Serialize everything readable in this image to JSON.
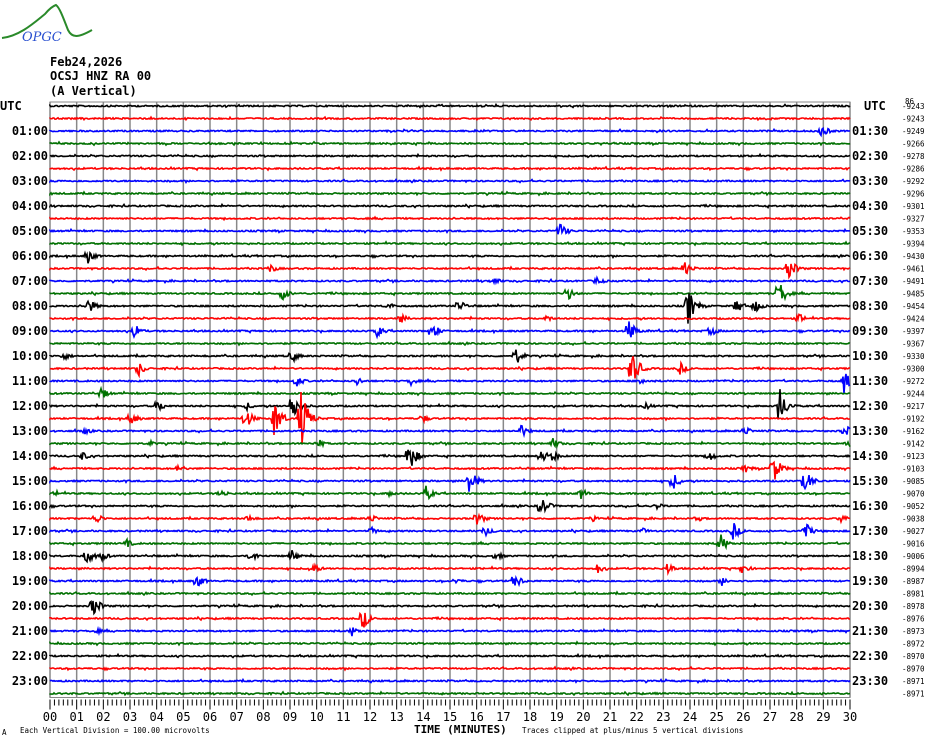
{
  "logo": {
    "text": "OPGC"
  },
  "header": {
    "date": "Feb24,2026",
    "station": "OCSJ HNZ RA 00",
    "component": "(A Vertical)"
  },
  "chart_data": {
    "type": "line",
    "title": "OCSJ HNZ RA 00 helicorder",
    "xlabel": "TIME (MINUTES)",
    "xlim": [
      0,
      30
    ],
    "x_ticks": [
      "00",
      "01",
      "02",
      "03",
      "04",
      "05",
      "06",
      "07",
      "08",
      "09",
      "10",
      "11",
      "12",
      "13",
      "14",
      "15",
      "16",
      "17",
      "18",
      "19",
      "20",
      "21",
      "22",
      "23",
      "24",
      "25",
      "26",
      "27",
      "28",
      "29",
      "30"
    ],
    "left_labels": [
      "UTC",
      "01:00",
      "02:00",
      "03:00",
      "04:00",
      "05:00",
      "06:00",
      "07:00",
      "08:00",
      "09:00",
      "10:00",
      "11:00",
      "12:00",
      "13:00",
      "14:00",
      "15:00",
      "16:00",
      "17:00",
      "18:00",
      "19:00",
      "20:00",
      "21:00",
      "22:00",
      "23:00"
    ],
    "right_labels": [
      "UTC",
      "01:30",
      "02:30",
      "03:30",
      "04:30",
      "05:30",
      "06:30",
      "07:30",
      "08:30",
      "09:30",
      "10:30",
      "11:30",
      "12:30",
      "13:30",
      "14:30",
      "15:30",
      "16:30",
      "17:30",
      "18:30",
      "19:30",
      "20:30",
      "21:30",
      "22:30",
      "23:30"
    ],
    "offset_top_label": "86",
    "trace_offsets": [
      "-9243",
      "-9243",
      "-9249",
      "-9266",
      "-9278",
      "-9286",
      "-9292",
      "-9296",
      "-9301",
      "-9327",
      "-9353",
      "-9394",
      "-9430",
      "-9461",
      "-9491",
      "-9485",
      "-9454",
      "-9424",
      "-9397",
      "-9367",
      "-9330",
      "-9300",
      "-9272",
      "-9244",
      "-9217",
      "-9192",
      "-9162",
      "-9142",
      "-9123",
      "-9103",
      "-9085",
      "-9070",
      "-9052",
      "-9038",
      "-9027",
      "-9016",
      "-9006",
      "-8994",
      "-8987",
      "-8981",
      "-8978",
      "-8976",
      "-8973",
      "-8972",
      "-8970",
      "-8970",
      "-8971",
      "-8971"
    ],
    "trace_colors": [
      "#000000",
      "#ff0000",
      "#0000ff",
      "#007000"
    ],
    "events_row_minute_amplitude_divisions": [
      [
        2,
        28.9,
        0.65
      ],
      [
        10,
        19.1,
        0.8
      ],
      [
        12,
        1.4,
        0.65
      ],
      [
        13,
        8.25,
        0.4
      ],
      [
        13,
        23.8,
        0.65
      ],
      [
        13,
        27.7,
        1.0
      ],
      [
        14,
        16.6,
        0.4
      ],
      [
        14,
        20.5,
        0.4
      ],
      [
        15,
        8.7,
        0.6
      ],
      [
        15,
        19.35,
        0.8
      ],
      [
        15,
        27.3,
        1.3
      ],
      [
        16,
        1.4,
        0.8
      ],
      [
        16,
        12.6,
        0.4
      ],
      [
        16,
        15.3,
        0.65
      ],
      [
        16,
        23.9,
        1.8
      ],
      [
        16,
        25.7,
        0.8
      ],
      [
        16,
        26.4,
        0.65
      ],
      [
        17,
        13.1,
        0.5
      ],
      [
        17,
        18.6,
        0.3
      ],
      [
        17,
        28.05,
        0.5
      ],
      [
        18,
        3.15,
        0.65
      ],
      [
        18,
        12.25,
        0.6
      ],
      [
        18,
        14.3,
        0.8
      ],
      [
        18,
        21.7,
        1.0
      ],
      [
        18,
        24.75,
        0.5
      ],
      [
        20,
        0.5,
        0.4
      ],
      [
        20,
        9.05,
        0.6
      ],
      [
        20,
        17.45,
        0.8
      ],
      [
        21,
        3.3,
        0.7
      ],
      [
        21,
        21.8,
        1.8
      ],
      [
        21,
        23.6,
        0.6
      ],
      [
        22,
        9.2,
        0.6
      ],
      [
        22,
        11.5,
        0.4
      ],
      [
        22,
        13.5,
        0.4
      ],
      [
        22,
        22.1,
        0.4
      ],
      [
        22,
        29.75,
        1.2
      ],
      [
        23,
        1.9,
        0.6
      ],
      [
        24,
        4.0,
        0.65
      ],
      [
        24,
        7.35,
        0.4
      ],
      [
        24,
        9.1,
        1.6
      ],
      [
        24,
        22.3,
        0.4
      ],
      [
        24,
        27.3,
        2.0
      ],
      [
        25,
        3.0,
        0.65
      ],
      [
        25,
        7.3,
        1.0
      ],
      [
        25,
        8.4,
        1.8
      ],
      [
        25,
        9.4,
        2.8
      ],
      [
        25,
        13.9,
        0.5
      ],
      [
        26,
        1.25,
        0.4
      ],
      [
        26,
        17.65,
        0.6
      ],
      [
        26,
        26.0,
        0.5
      ],
      [
        26,
        29.8,
        0.6
      ],
      [
        27,
        3.7,
        0.3
      ],
      [
        27,
        10.0,
        0.5
      ],
      [
        27,
        18.85,
        0.5
      ],
      [
        27,
        29.9,
        0.4
      ],
      [
        28,
        1.2,
        0.4
      ],
      [
        28,
        13.4,
        1.8
      ],
      [
        28,
        18.4,
        0.65
      ],
      [
        28,
        18.8,
        0.6
      ],
      [
        28,
        24.7,
        0.5
      ],
      [
        29,
        4.8,
        0.4
      ],
      [
        29,
        26.05,
        0.4
      ],
      [
        29,
        27.1,
        1.4
      ],
      [
        30,
        15.7,
        1.3
      ],
      [
        30,
        23.35,
        0.8
      ],
      [
        30,
        28.3,
        1.1
      ],
      [
        31,
        0.2,
        0.3
      ],
      [
        31,
        6.4,
        0.4
      ],
      [
        31,
        12.7,
        0.3
      ],
      [
        31,
        14.1,
        0.65
      ],
      [
        31,
        19.9,
        0.5
      ],
      [
        32,
        18.4,
        1.0
      ],
      [
        32,
        22.75,
        0.3
      ],
      [
        33,
        1.7,
        0.5
      ],
      [
        33,
        7.4,
        0.4
      ],
      [
        33,
        12.0,
        0.4
      ],
      [
        33,
        16.0,
        0.65
      ],
      [
        33,
        20.3,
        0.3
      ],
      [
        33,
        24.25,
        0.3
      ],
      [
        33,
        29.65,
        0.4
      ],
      [
        34,
        12.0,
        0.4
      ],
      [
        34,
        16.3,
        0.5
      ],
      [
        34,
        22.2,
        0.3
      ],
      [
        34,
        25.6,
        0.8
      ],
      [
        34,
        28.3,
        0.8
      ],
      [
        35,
        2.85,
        0.4
      ],
      [
        35,
        25.1,
        1.0
      ],
      [
        36,
        1.35,
        0.8
      ],
      [
        36,
        1.95,
        0.4
      ],
      [
        36,
        7.5,
        0.6
      ],
      [
        36,
        9.05,
        0.6
      ],
      [
        36,
        16.7,
        0.4
      ],
      [
        37,
        9.8,
        0.65
      ],
      [
        37,
        20.5,
        0.5
      ],
      [
        37,
        23.1,
        0.65
      ],
      [
        37,
        25.95,
        0.5
      ],
      [
        38,
        5.5,
        0.65
      ],
      [
        38,
        15.2,
        0.3
      ],
      [
        38,
        17.4,
        0.8
      ],
      [
        38,
        25.2,
        0.4
      ],
      [
        40,
        1.6,
        1.0
      ],
      [
        41,
        11.7,
        1.0
      ],
      [
        42,
        1.7,
        0.3
      ],
      [
        42,
        11.3,
        0.5
      ]
    ]
  },
  "footer": {
    "mark": "A",
    "scale_note": "Each Vertical Division =  100.00 microvolts",
    "clip_note": "Traces clipped at plus/minus 5 vertical divisions"
  }
}
